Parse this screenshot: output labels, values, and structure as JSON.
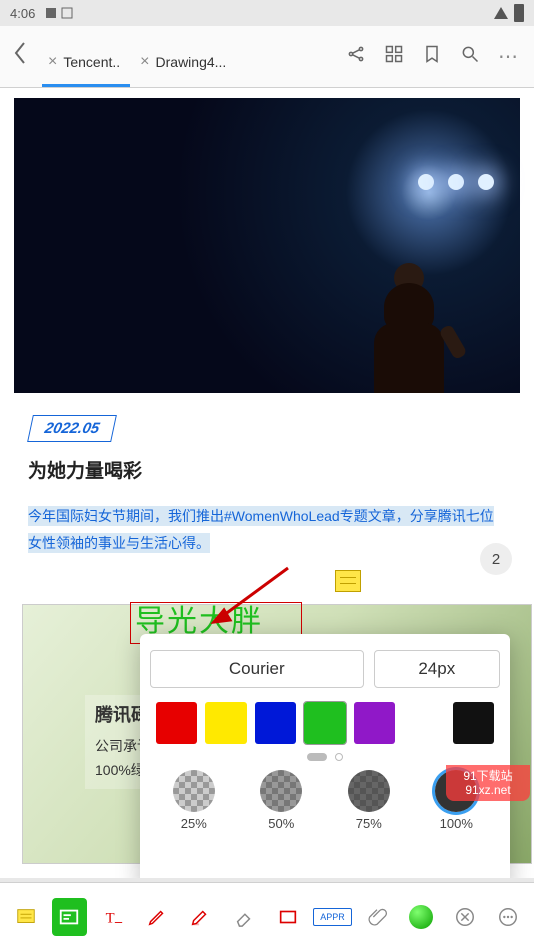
{
  "status": {
    "time": "4:06"
  },
  "tabs": [
    {
      "label": "Tencent..",
      "active": true
    },
    {
      "label": "Drawing4...",
      "active": false
    }
  ],
  "article": {
    "date": "2022.05",
    "title": "为她力量喝彩",
    "para": "今年国际妇女节期间，我们推出#WomenWhoLead专题文章，分享腾讯七位女性领袖的事业与生活心得。",
    "page_number": "2"
  },
  "annotation": {
    "note_icon": "sticky-note",
    "text_box": "导光大胖"
  },
  "company_card": {
    "title": "腾讯碌",
    "line1": "公司承讠",
    "line2": "100%绿"
  },
  "text_style_popup": {
    "font": "Courier",
    "size": "24px",
    "colors": [
      "red",
      "yellow",
      "blue",
      "green",
      "purple",
      "black"
    ],
    "selected_color": "green",
    "opacities": [
      "25%",
      "50%",
      "75%",
      "100%"
    ],
    "selected_opacity": "100%"
  },
  "brand": {
    "line1": "91下载站",
    "line2": "91xz.net"
  },
  "toolbar_bottom": {
    "appr_label": "APPR"
  }
}
